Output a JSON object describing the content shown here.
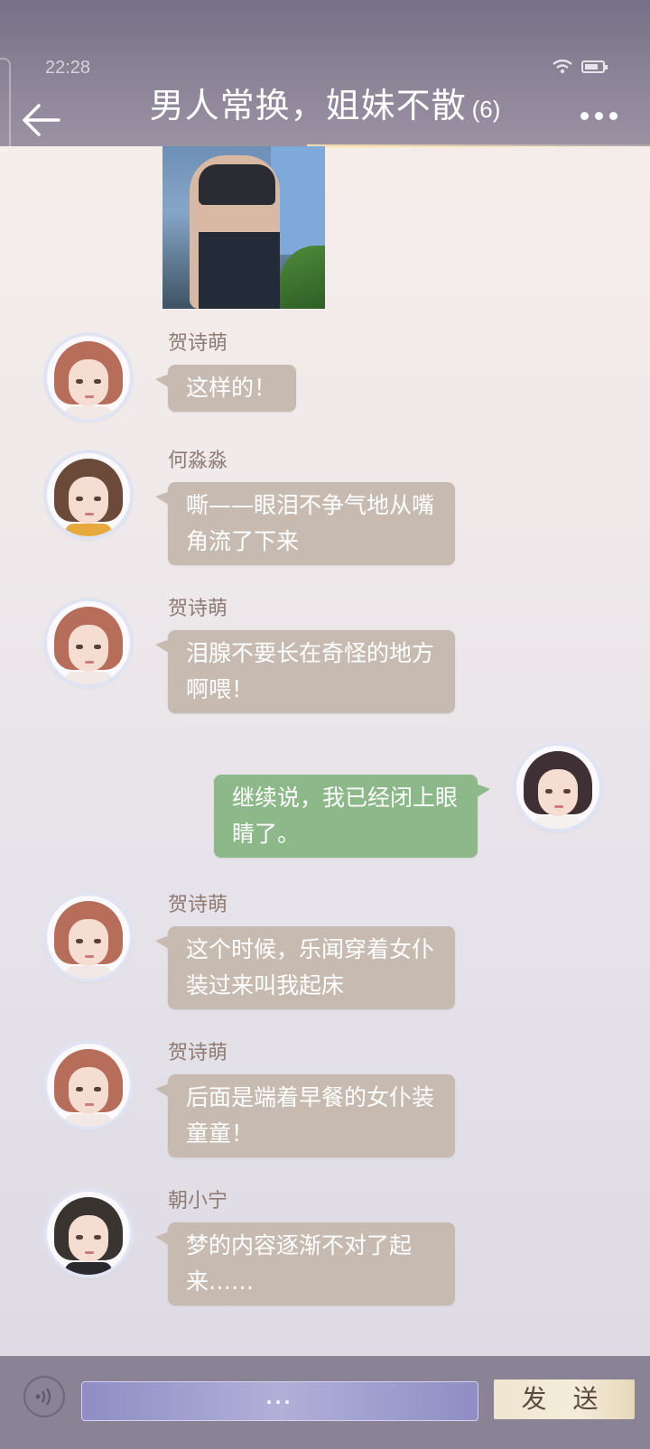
{
  "status_bar": {
    "time": "22:28"
  },
  "header": {
    "title": "男人常换，姐妹不散",
    "member_count": "(6)"
  },
  "messages": [
    {
      "sender": "贺诗萌",
      "text": "这样的！"
    },
    {
      "sender": "何淼淼",
      "text": "嘶——眼泪不争气地从嘴角流了下来"
    },
    {
      "sender": "贺诗萌",
      "text": "泪腺不要长在奇怪的地方啊喂！"
    },
    {
      "sender": "",
      "text": "继续说，我已经闭上眼睛了。"
    },
    {
      "sender": "贺诗萌",
      "text": "这个时候，乐闻穿着女仆装过来叫我起床"
    },
    {
      "sender": "贺诗萌",
      "text": "后面是端着早餐的女仆装童童！"
    },
    {
      "sender": "朝小宁",
      "text": "梦的内容逐渐不对了起来……"
    }
  ],
  "input_bar": {
    "input_value": "…",
    "send_label": "发 送"
  },
  "colors": {
    "header_bg": "#8c8497",
    "incoming_bubble": "#c7bbb1",
    "outgoing_bubble": "#8db889",
    "sender_name": "#8e7b73"
  },
  "icons": [
    "wifi-icon",
    "battery-icon",
    "back-arrow-icon",
    "more-icon",
    "voice-icon"
  ]
}
